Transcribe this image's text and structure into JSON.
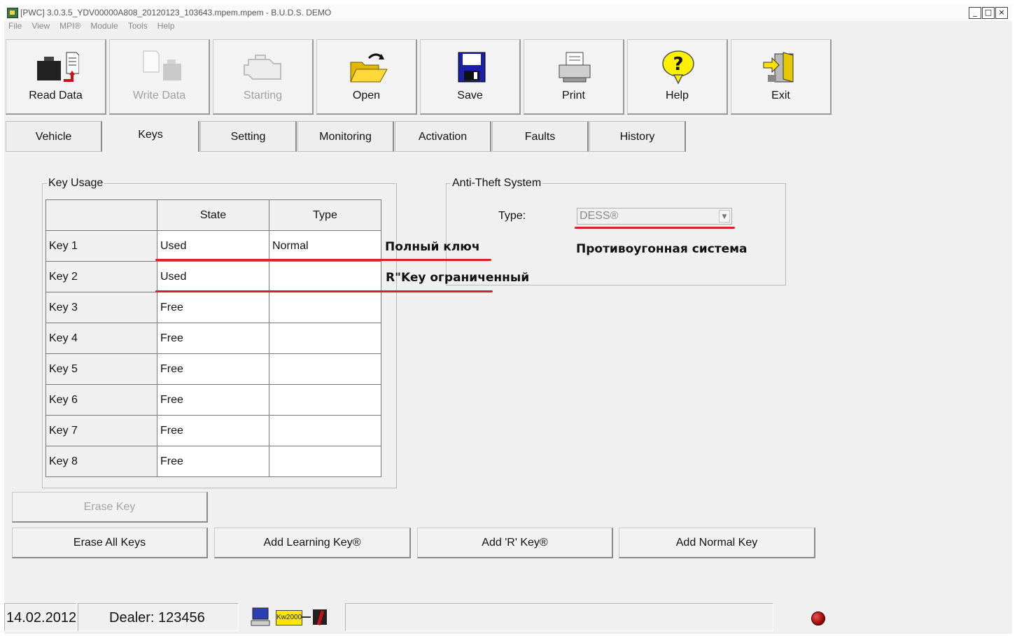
{
  "window": {
    "title": "[PWC] 3.0.3.5_YDV00000A808_20120123_103643.mpem.mpem - B.U.D.S. DEMO",
    "minimize": "_",
    "maximize": "□",
    "close": "×"
  },
  "menu": [
    "File",
    "View",
    "MPI®",
    "Module",
    "Tools",
    "Help"
  ],
  "toolbar": [
    {
      "label": "Read Data",
      "icon": "read-data-icon",
      "enabled": true
    },
    {
      "label": "Write Data",
      "icon": "write-data-icon",
      "enabled": false
    },
    {
      "label": "Starting",
      "icon": "engine-icon",
      "enabled": false
    },
    {
      "label": "Open",
      "icon": "open-folder-icon",
      "enabled": true
    },
    {
      "label": "Save",
      "icon": "floppy-disk-icon",
      "enabled": true
    },
    {
      "label": "Print",
      "icon": "printer-icon",
      "enabled": true
    },
    {
      "label": "Help",
      "icon": "help-icon",
      "enabled": true
    },
    {
      "label": "Exit",
      "icon": "exit-door-icon",
      "enabled": true
    }
  ],
  "tabs": [
    "Vehicle",
    "Keys",
    "Setting",
    "Monitoring",
    "Activation",
    "Faults",
    "History"
  ],
  "active_tab": "Keys",
  "key_usage": {
    "title": "Key Usage",
    "columns": [
      "State",
      "Type"
    ],
    "rows": [
      {
        "key": "Key 1",
        "state": "Used",
        "type": "Normal"
      },
      {
        "key": "Key 2",
        "state": "Used",
        "type": ""
      },
      {
        "key": "Key 3",
        "state": "Free",
        "type": ""
      },
      {
        "key": "Key 4",
        "state": "Free",
        "type": ""
      },
      {
        "key": "Key 5",
        "state": "Free",
        "type": ""
      },
      {
        "key": "Key 6",
        "state": "Free",
        "type": ""
      },
      {
        "key": "Key 7",
        "state": "Free",
        "type": ""
      },
      {
        "key": "Key 8",
        "state": "Free",
        "type": ""
      }
    ]
  },
  "anti_theft": {
    "title": "Anti-Theft System",
    "type_label": "Type:",
    "type_value": "DESS®"
  },
  "annotations": {
    "key1": "Полный ключ",
    "key2": "R\"Key ограниченный",
    "anti_theft": "Противоугонная система",
    "color": "#d8202a"
  },
  "buttons": {
    "erase_key": "Erase Key",
    "erase_all_keys": "Erase All Keys",
    "add_learning_key": "Add Learning Key®",
    "add_r_key": "Add 'R' Key®",
    "add_normal_key": "Add Normal Key"
  },
  "status": {
    "date": "14.02.2012",
    "dealer": "Dealer: 123456",
    "protocol": "Kw2000",
    "led_color": "#c00000"
  }
}
